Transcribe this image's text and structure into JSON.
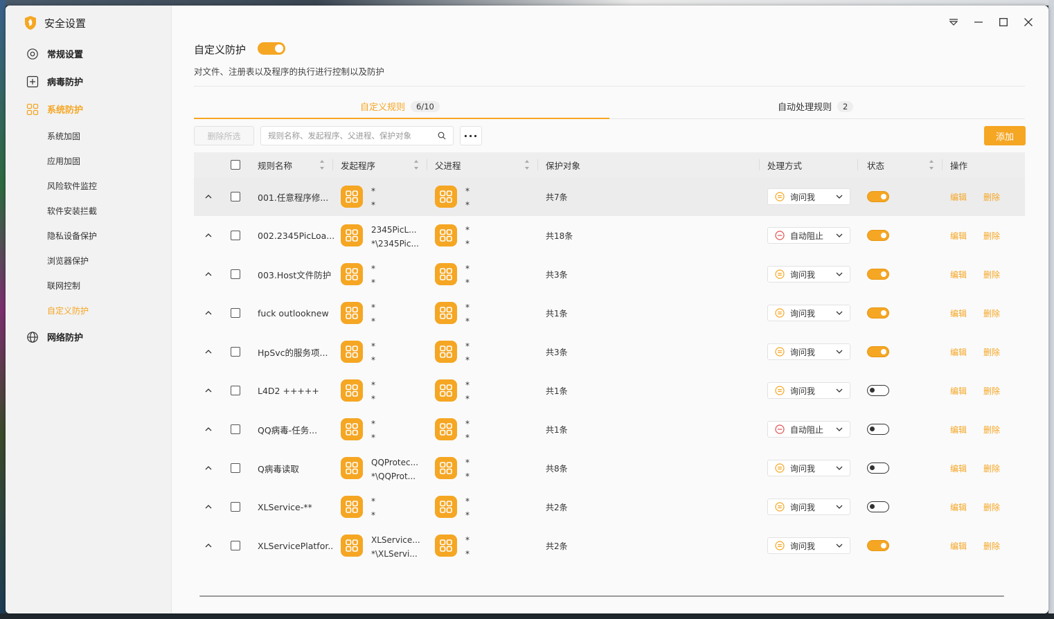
{
  "window": {
    "title": "安全设置"
  },
  "sidebar": {
    "items": [
      {
        "label": "常规设置",
        "icon": "gear-icon"
      },
      {
        "label": "病毒防护",
        "icon": "plus-square-icon"
      },
      {
        "label": "系统防护",
        "icon": "grid-icon"
      },
      {
        "label": "网络防护",
        "icon": "globe-icon"
      }
    ],
    "sub_items": [
      "系统加固",
      "应用加固",
      "风险软件监控",
      "软件安装拦截",
      "隐私设备保护",
      "浏览器保护",
      "联网控制",
      "自定义防护"
    ]
  },
  "header": {
    "title": "自定义防护",
    "enabled": true,
    "description": "对文件、注册表以及程序的执行进行控制以及防护"
  },
  "tabs": [
    {
      "label": "自定义规则",
      "badge": "6/10"
    },
    {
      "label": "自动处理规则",
      "badge": "2"
    }
  ],
  "toolbar": {
    "delete_selected": "删除所选",
    "search_placeholder": "规则名称、发起程序、父进程、保护对象",
    "more": "···",
    "add": "添加"
  },
  "table": {
    "columns": [
      "规则名称",
      "发起程序",
      "父进程",
      "保护对象",
      "处理方式",
      "状态",
      "操作"
    ],
    "edit_label": "编辑",
    "delete_label": "删除",
    "rows": [
      {
        "name": "001.任意程序修...",
        "initiator": [
          "*",
          "*"
        ],
        "parent": [
          "*",
          "*"
        ],
        "protect": "共7条",
        "handling": "询问我",
        "handling_type": "ask",
        "enabled": true
      },
      {
        "name": "002.2345PicLoa...",
        "initiator": [
          "2345PicL...",
          "*\\2345Pic..."
        ],
        "parent": [
          "*",
          "*"
        ],
        "protect": "共18条",
        "handling": "自动阻止",
        "handling_type": "block",
        "enabled": true
      },
      {
        "name": "003.Host文件防护",
        "initiator": [
          "*",
          "*"
        ],
        "parent": [
          "*",
          "*"
        ],
        "protect": "共3条",
        "handling": "询问我",
        "handling_type": "ask",
        "enabled": true
      },
      {
        "name": "fuck outlooknew",
        "initiator": [
          "*",
          "*"
        ],
        "parent": [
          "*",
          "*"
        ],
        "protect": "共1条",
        "handling": "询问我",
        "handling_type": "ask",
        "enabled": true
      },
      {
        "name": "HpSvc的服务项...",
        "initiator": [
          "*",
          "*"
        ],
        "parent": [
          "*",
          "*"
        ],
        "protect": "共3条",
        "handling": "询问我",
        "handling_type": "ask",
        "enabled": true
      },
      {
        "name": "L4D2 +++++",
        "initiator": [
          "*",
          "*"
        ],
        "parent": [
          "*",
          "*"
        ],
        "protect": "共1条",
        "handling": "询问我",
        "handling_type": "ask",
        "enabled": false
      },
      {
        "name": "QQ病毒-任务...",
        "initiator": [
          "*",
          "*"
        ],
        "parent": [
          "*",
          "*"
        ],
        "protect": "共1条",
        "handling": "自动阻止",
        "handling_type": "block",
        "enabled": false
      },
      {
        "name": "Q病毒读取",
        "initiator": [
          "QQProtec...",
          "*\\QQProt..."
        ],
        "parent": [
          "*",
          "*"
        ],
        "protect": "共8条",
        "handling": "询问我",
        "handling_type": "ask",
        "enabled": false
      },
      {
        "name": "XLService-**",
        "initiator": [
          "*",
          "*"
        ],
        "parent": [
          "*",
          "*"
        ],
        "protect": "共2条",
        "handling": "询问我",
        "handling_type": "ask",
        "enabled": false
      },
      {
        "name": "XLServicePlatfor...",
        "initiator": [
          "XLService...",
          "*\\XLServi..."
        ],
        "parent": [
          "*",
          "*"
        ],
        "protect": "共2条",
        "handling": "询问我",
        "handling_type": "ask",
        "enabled": true
      }
    ]
  },
  "colors": {
    "accent": "#f5a623",
    "block": "#e05050"
  }
}
